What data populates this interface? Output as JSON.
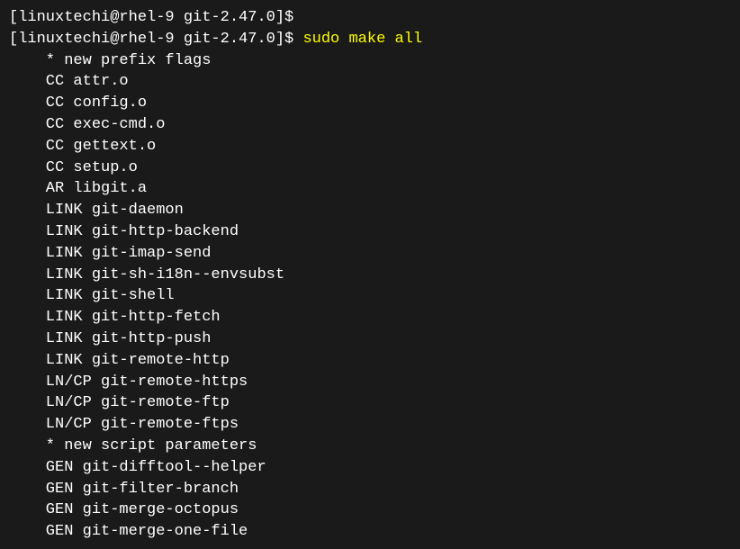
{
  "prompt1": "[linuxtechi@rhel-9 git-2.47.0]$",
  "prompt2": "[linuxtechi@rhel-9 git-2.47.0]$ ",
  "command": "sudo make all",
  "output_lines": [
    "    * new prefix flags",
    "    CC attr.o",
    "    CC config.o",
    "    CC exec-cmd.o",
    "    CC gettext.o",
    "    CC setup.o",
    "    AR libgit.a",
    "    LINK git-daemon",
    "    LINK git-http-backend",
    "    LINK git-imap-send",
    "    LINK git-sh-i18n--envsubst",
    "    LINK git-shell",
    "    LINK git-http-fetch",
    "    LINK git-http-push",
    "    LINK git-remote-http",
    "    LN/CP git-remote-https",
    "    LN/CP git-remote-ftp",
    "    LN/CP git-remote-ftps",
    "    * new script parameters",
    "    GEN git-difftool--helper",
    "    GEN git-filter-branch",
    "    GEN git-merge-octopus",
    "    GEN git-merge-one-file"
  ]
}
